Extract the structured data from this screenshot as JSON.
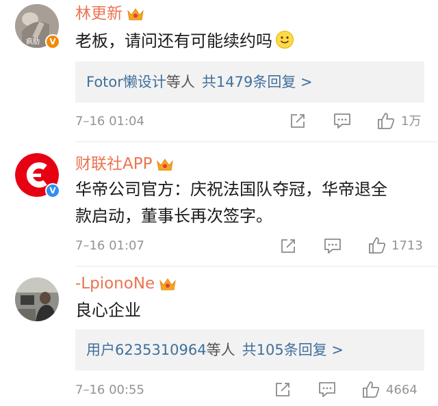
{
  "comments": [
    {
      "username": "林更新",
      "avatar_watermark": "疯肋",
      "text": "老板，请问还有可能续约吗",
      "has_emoji": true,
      "reply_summary": {
        "names": "Fotor懒设计",
        "suffix": "等人",
        "count_text": "共1479条回复 >"
      },
      "time": "7–16 01:04",
      "likes": "1万"
    },
    {
      "username": "财联社APP",
      "text_line1": "华帝公司官方：庆祝法国队夺冠，华帝退全",
      "text_line2": "款启动，董事长再次签字。",
      "time": "7–16 01:07",
      "likes": "1713"
    },
    {
      "username": "-LpionoNe",
      "text": "良心企业",
      "reply_summary": {
        "names": "用户6235310964",
        "suffix": "等人",
        "count_text": "共105条回复 >"
      },
      "time": "7–16 00:55",
      "likes": "4664"
    }
  ],
  "colors": {
    "username": "#eb7350",
    "link": "#3f6f9c",
    "meta": "#939393",
    "reply_bg": "#f2f2f2",
    "crown": "#f5a623"
  },
  "icons": [
    "crown-icon",
    "verified-badge-icon",
    "smile-emoji-icon",
    "share-icon",
    "comment-icon",
    "like-icon"
  ]
}
